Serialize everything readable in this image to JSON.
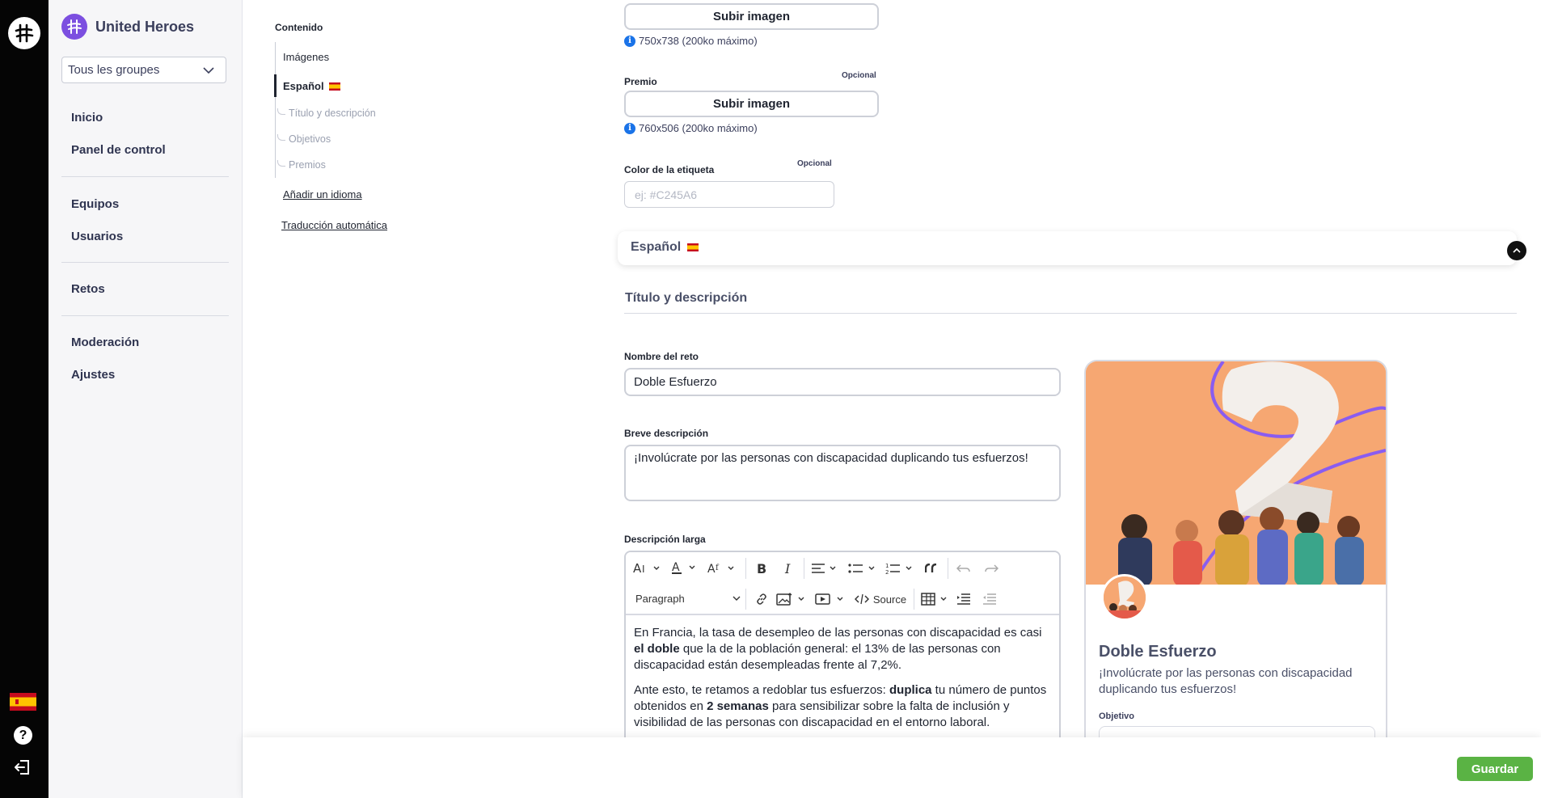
{
  "brand": {
    "name": "United Heroes"
  },
  "sidebar": {
    "group_select": "Tous les groupes",
    "items": [
      {
        "label": "Inicio"
      },
      {
        "label": "Panel de control"
      },
      {
        "label": "Equipos"
      },
      {
        "label": "Usuarios"
      },
      {
        "label": "Retos"
      },
      {
        "label": "Moderación"
      },
      {
        "label": "Ajustes"
      }
    ]
  },
  "toc": {
    "title": "Contenido",
    "images": "Imágenes",
    "language": "Español",
    "subs": [
      "Título y descripción",
      "Objetivos",
      "Premios"
    ],
    "add_language": "Añadir un idioma",
    "auto_translate": "Traducción automática"
  },
  "uploads": {
    "button_label": "Subir imagen",
    "main_hint": "750x738 (200ko máximo)",
    "prize_label": "Premio",
    "prize_hint": "760x506 (200ko máximo)",
    "optional": "Opcional"
  },
  "tag_color": {
    "label": "Color de la etiqueta",
    "optional": "Opcional",
    "placeholder": "ej: #C245A6"
  },
  "language_panel": {
    "label": "Español"
  },
  "section": {
    "title": "Título y descripción"
  },
  "form": {
    "name_label": "Nombre del reto",
    "name_value": "Doble Esfuerzo",
    "short_label": "Breve descripción",
    "short_value": "¡Involúcrate por las personas con discapacidad duplicando tus esfuerzos!",
    "long_label": "Descripción larga"
  },
  "editor": {
    "paragraph": "Paragraph",
    "source": "Source",
    "p1_a": "En Francia, la tasa de desempleo de las personas con discapacidad es casi ",
    "p1_b": "el doble",
    "p1_c": " que la de la población general: el 13% de las personas con discapacidad están desempleadas frente al 7,2%.",
    "p2_a": "Ante esto, te retamos a redoblar tus esfuerzos: ",
    "p2_b": "duplica",
    "p2_c": " tu número de puntos obtenidos en ",
    "p2_d": "2 semanas",
    "p2_e": " para sensibilizar sobre la falta de inclusión y visibilidad de las personas con discapacidad en el entorno laboral."
  },
  "preview": {
    "title": "Doble Esfuerzo",
    "description": "¡Involúcrate por las personas con discapacidad duplicando tus esfuerzos!",
    "objective_label": "Objetivo"
  },
  "footer": {
    "save": "Guardar"
  },
  "colors": {
    "accent": "#7c4fe0",
    "save": "#5ab344",
    "info": "#1a73e8",
    "art": "#f6a772"
  }
}
